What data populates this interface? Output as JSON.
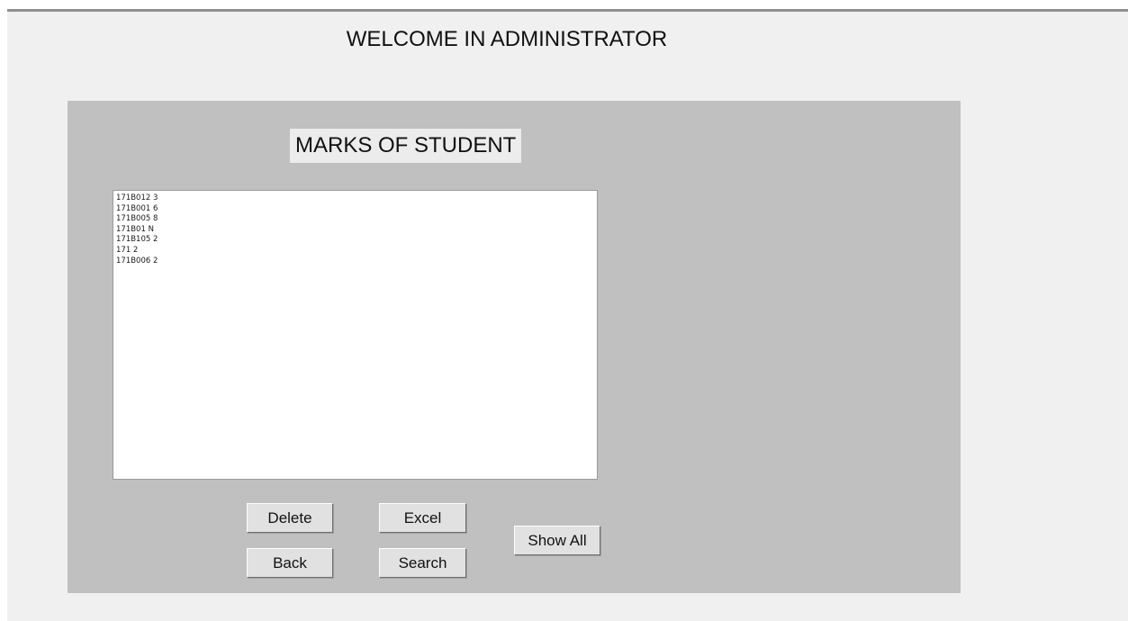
{
  "header": {
    "welcome_text": "WELCOME IN ADMINISTRATOR"
  },
  "panel": {
    "title": "MARKS OF STUDENT",
    "list_items": [
      "171B012 3",
      "171B001 6",
      "171B005 8",
      "171B01 N",
      "171B105 2",
      "171 2",
      "171B006 2"
    ]
  },
  "buttons": {
    "delete": "Delete",
    "back": "Back",
    "excel": "Excel",
    "search": "Search",
    "show_all": "Show All"
  },
  "colors": {
    "window_background": "#f0f0f0",
    "panel_background": "#c0c0c0",
    "title_background": "#ececec",
    "button_face": "#e1e1e1"
  }
}
